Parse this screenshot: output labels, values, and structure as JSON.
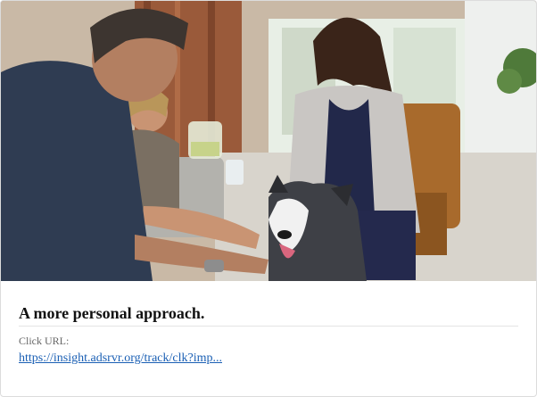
{
  "card": {
    "headline": "A more personal approach.",
    "click_url_label": "Click URL:",
    "click_url": "https://insight.adsrvr.org/track/clk?imp...",
    "link_color": "#1a5fb4"
  },
  "hero_image": {
    "description_icon": "photo-icon"
  }
}
